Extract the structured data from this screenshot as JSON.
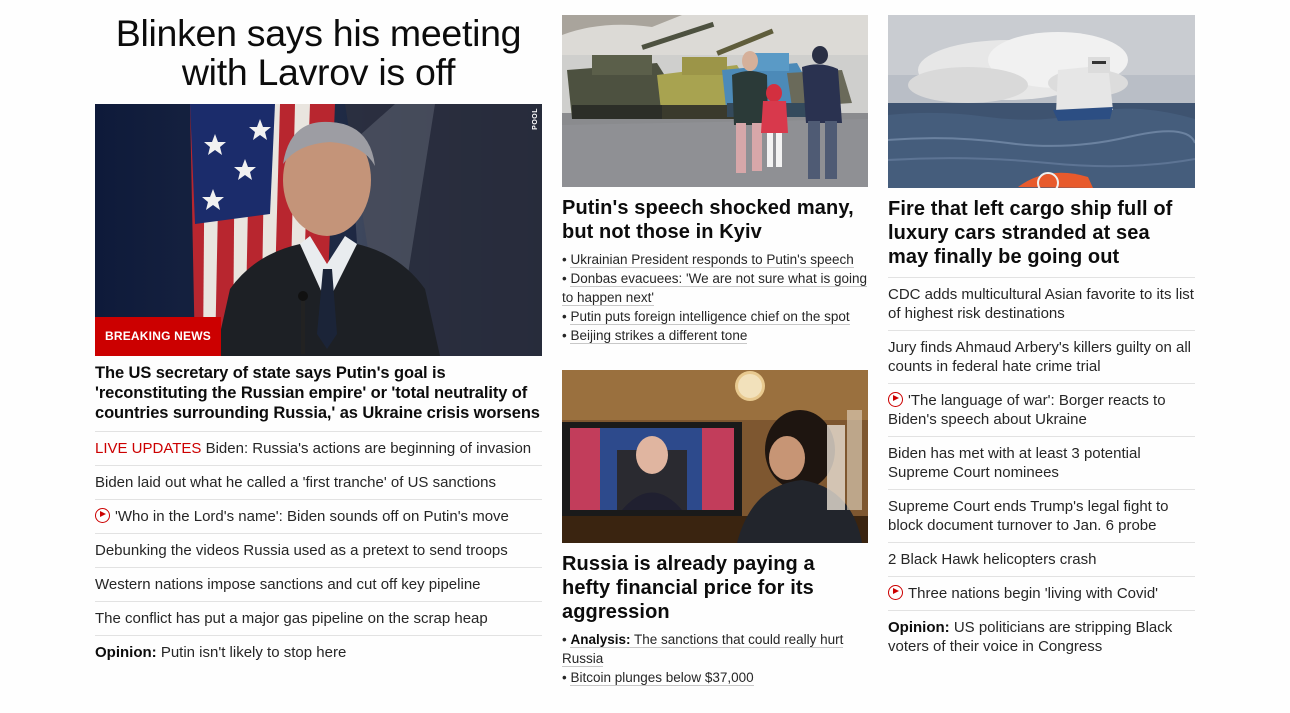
{
  "lead": {
    "title_line1": "Blinken says his meeting",
    "title_line2": "with Lavrov is off",
    "badge": "BREAKING NEWS",
    "pool_label": "POOL",
    "description": "The US secretary of state says Putin's goal is 'reconstituting the Russian empire' or 'total neutrality of countries surrounding Russia,' as Ukraine crisis worsens",
    "items": [
      {
        "prefix": "LIVE UPDATES",
        "text": " Biden: Russia's actions are beginning of invasion"
      },
      {
        "text": "Biden laid out what he called a 'first tranche' of US sanctions"
      },
      {
        "video": true,
        "text": "'Who in the Lord's name': Biden sounds off on Putin's move"
      },
      {
        "text": "Debunking the videos Russia used as a pretext to send troops"
      },
      {
        "text": "Western nations impose sanctions and cut off key pipeline"
      },
      {
        "text": "The conflict has put a major gas pipeline on the scrap heap"
      },
      {
        "bold": "Opinion:",
        "text": " Putin isn't likely to stop here"
      }
    ]
  },
  "middle": {
    "story1": {
      "headline": "Putin's speech shocked many, but not those in Kyiv",
      "bullets": [
        "Ukrainian President responds to Putin's speech",
        "Donbas evacuees: 'We are not sure what is going to happen next'",
        "Putin puts foreign intelligence chief on the spot",
        "Beijing strikes a different tone"
      ]
    },
    "story2": {
      "headline": "Russia is already paying a hefty financial price for its aggression",
      "bullet1_bold": "Analysis:",
      "bullet1_text": " The sanctions that could really hurt Russia",
      "bullet2": "Bitcoin plunges below $37,000"
    }
  },
  "right": {
    "headline": "Fire that left cargo ship full of luxury cars stranded at sea may finally be going out",
    "items": [
      {
        "text": "CDC adds multicultural Asian favorite to its list of highest risk destinations"
      },
      {
        "text": "Jury finds Ahmaud Arbery's killers guilty on all counts in federal hate crime trial"
      },
      {
        "video": true,
        "text": "'The language of war': Borger reacts to Biden's speech about Ukraine"
      },
      {
        "text": "Biden has met with at least 3 potential Supreme Court nominees"
      },
      {
        "text": "Supreme Court ends Trump's legal fight to block document turnover to Jan. 6 probe"
      },
      {
        "text": "2 Black Hawk helicopters crash"
      },
      {
        "video": true,
        "text": "Three nations begin 'living with Covid'"
      },
      {
        "bold": "Opinion:",
        "text": " US politicians are stripping Black voters of their voice in Congress"
      }
    ]
  },
  "colors": {
    "accent": "#cc0000",
    "text": "#0c0c0c",
    "divider": "#e2e2e2"
  },
  "icons": {
    "video": "play-circle-icon"
  }
}
